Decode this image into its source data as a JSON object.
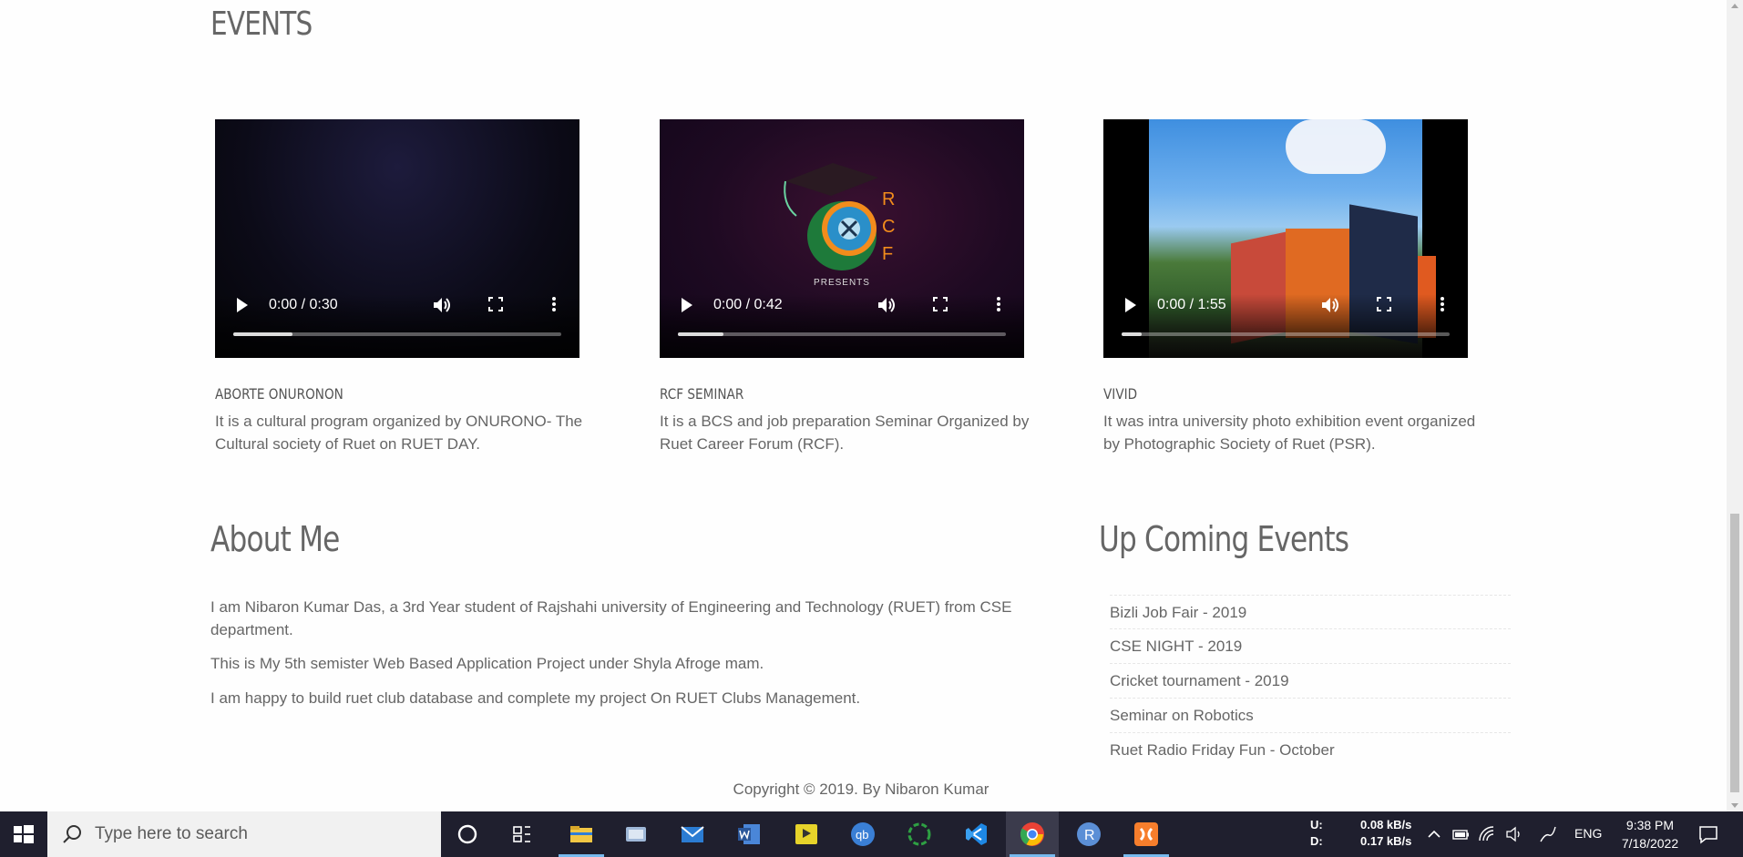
{
  "page": {
    "events_heading": "EVENTS",
    "events": [
      {
        "title": "ABORTE ONURONON",
        "description": "It is a cultural program organized by ONURONO- The Cultural society of Ruet on RUET DAY.",
        "video_time": "0:00 / 0:30",
        "buffered": 0.18
      },
      {
        "title": "RCF SEMINAR",
        "description": "It is a BCS and job preparation Seminar Organized by Ruet Career Forum (RCF).",
        "video_time": "0:00 / 0:42",
        "buffered": 0.14,
        "overlay_text": "PRESENTS",
        "logo_letters": [
          "R",
          "C",
          "F"
        ]
      },
      {
        "title": "VIVID",
        "description": "It was intra university photo exhibition event organized by Photographic Society of Ruet (PSR).",
        "video_time": "0:00 / 1:55",
        "buffered": 0.06
      }
    ],
    "about": {
      "heading": "About Me",
      "paragraphs": [
        "I am Nibaron Kumar Das, a 3rd Year student of Rajshahi university of Engineering and Technology (RUET) from CSE department.",
        "This is My 5th semister Web Based Application Project under Shyla Afroge mam.",
        "I am happy to build ruet club database and complete my project On RUET Clubs Management."
      ]
    },
    "upcoming": {
      "heading": "Up Coming Events",
      "items": [
        "Bizli Job Fair - 2019",
        "CSE NIGHT - 2019",
        "Cricket tournament - 2019",
        "Seminar on Robotics",
        "Ruet Radio Friday Fun - October"
      ]
    },
    "copyright": "Copyright © 2019. By Nibaron Kumar"
  },
  "taskbar": {
    "search_placeholder": "Type here to search",
    "apps": [
      {
        "name": "cortana-icon",
        "color": "#ffffff"
      },
      {
        "name": "task-view-icon",
        "color": "#ffffff"
      },
      {
        "name": "file-explorer-icon",
        "color": "#f2c744"
      },
      {
        "name": "photos-app-icon",
        "color": "#9fb8d8"
      },
      {
        "name": "mail-icon",
        "color": "#2b7cd3"
      },
      {
        "name": "word-icon",
        "color": "#2b579a"
      },
      {
        "name": "kmplayer-icon",
        "color": "#e6d32a"
      },
      {
        "name": "qbittorrent-icon",
        "color": "#3a7fd5"
      },
      {
        "name": "sync-app-icon",
        "color": "#2ea043"
      },
      {
        "name": "vscode-icon",
        "color": "#1e88e5"
      },
      {
        "name": "chrome-icon",
        "color": "#e94235"
      },
      {
        "name": "r-language-icon",
        "color": "#5b8fd6"
      },
      {
        "name": "xampp-icon",
        "color": "#f77e2c"
      }
    ],
    "net_upload_label": "U:",
    "net_upload_value": "0.08 kB/s",
    "net_download_label": "D:",
    "net_download_value": "0.17 kB/s",
    "language": "ENG",
    "time": "9:38 PM",
    "date": "7/18/2022"
  }
}
